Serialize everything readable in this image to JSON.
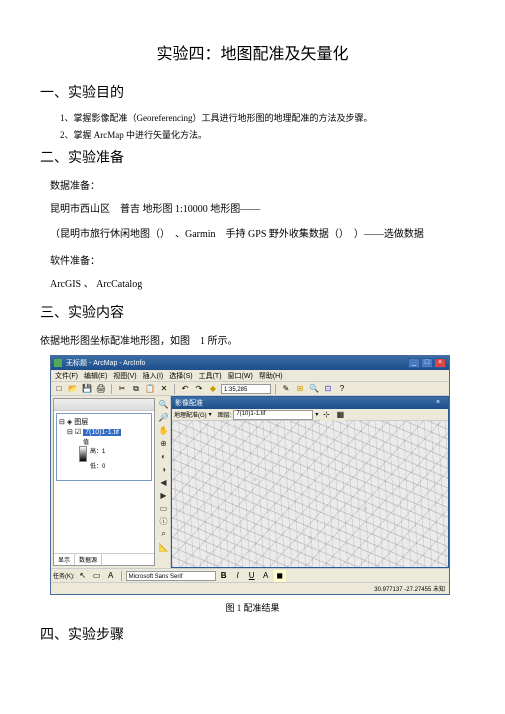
{
  "title": "实验四：地图配准及矢量化",
  "section1": {
    "heading": "一、实验目的",
    "item1": "1、掌握影像配准（Georeferencing）工具进行地形图的地理配准的方法及步骤。",
    "item2": "2、掌握 ArcMap 中进行矢量化方法。"
  },
  "section2": {
    "heading": "二、实验准备",
    "sub1": "数据准备：",
    "line1": "昆明市西山区　普吉 地形图 1:10000 地形图——",
    "line2": "（昆明市旅行休闲地图（）　、Garmin　手持 GPS 野外收集数据（）　）——选做数据",
    "sub2": "软件准备：",
    "line3": "ArcGIS 、 ArcCatalog"
  },
  "section3": {
    "heading": "三、实验内容",
    "intro": "依据地形图坐标配准地形图，如图　1 所示。"
  },
  "figure_caption": "图 1 配准结果",
  "section4": {
    "heading": "四、实验步骤"
  },
  "app": {
    "window_title": "无标题 - ArcMap - ArcInfo",
    "menus": [
      "文件(F)",
      "编辑(E)",
      "视图(V)",
      "插入(I)",
      "选择(S)",
      "工具(T)",
      "窗口(W)",
      "帮助(H)"
    ],
    "scale": "1:35,285",
    "toc": {
      "root": "图层",
      "layer": "7(10)1-1.tif",
      "value_label": "值",
      "high": "高：1",
      "low": "低：0",
      "tab1": "显示",
      "tab2": "数据源"
    },
    "inner_title": "影像配准",
    "inner_tool_label": "地理配准(G)",
    "inner_layer": "7(10)1-1.tif",
    "task_label": "任务(K):",
    "task_value": "Microsoft Sans Serif",
    "coords": "30.977137 -27.27455 未知"
  }
}
